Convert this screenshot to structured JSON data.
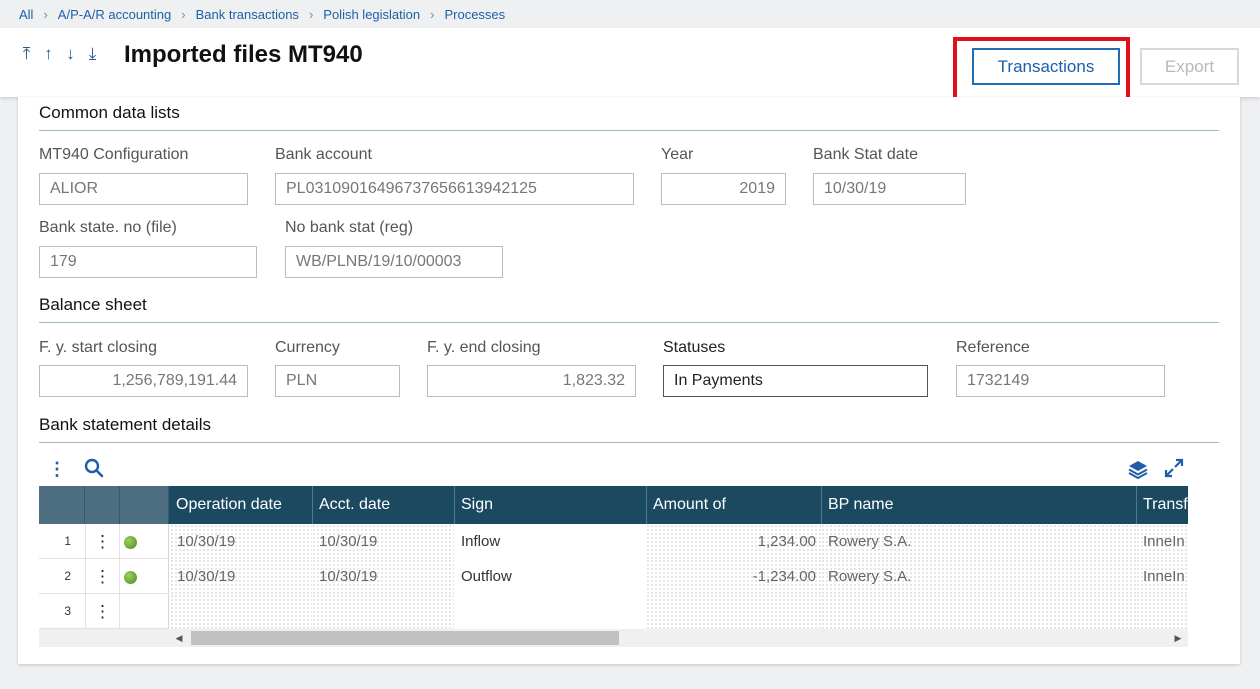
{
  "breadcrumb": [
    "All",
    "A/P-A/R accounting",
    "Bank transactions",
    "Polish legislation",
    "Processes"
  ],
  "header": {
    "title": "Imported files MT940",
    "nav": {
      "first": "⤒",
      "prev": "↑",
      "next": "↓",
      "last": "⤓"
    },
    "transactions_label": "Transactions",
    "export_label": "Export"
  },
  "common": {
    "title": "Common data lists",
    "config_label": "MT940 Configuration",
    "config_value": "ALIOR",
    "account_label": "Bank account",
    "account_value": "PL03109016496737656613942125",
    "year_label": "Year",
    "year_value": "2019",
    "statdate_label": "Bank Stat date",
    "statdate_value": "10/30/19",
    "stateno_label": "Bank state. no (file)",
    "stateno_value": "179",
    "nostat_label": "No bank stat (reg)",
    "nostat_value": "WB/PLNB/19/10/00003"
  },
  "balance": {
    "title": "Balance sheet",
    "start_label": "F. y. start closing",
    "start_value": "1,256,789,191.44",
    "currency_label": "Currency",
    "currency_value": "PLN",
    "end_label": "F. y. end closing",
    "end_value": "1,823.32",
    "statuses_label": "Statuses",
    "statuses_value": "In Payments",
    "reference_label": "Reference",
    "reference_value": "1732149"
  },
  "details": {
    "title": "Bank statement details",
    "columns": [
      "Operation date",
      "Acct. date",
      "Sign",
      "Amount of",
      "BP name",
      "Transfer"
    ],
    "rows": [
      {
        "num": "1",
        "op": "10/30/19",
        "acct": "10/30/19",
        "sign": "Inflow",
        "amount": "1,234.00",
        "bp": "Rowery S.A.",
        "transfer": "InneIn"
      },
      {
        "num": "2",
        "op": "10/30/19",
        "acct": "10/30/19",
        "sign": "Outflow",
        "amount": "-1,234.00",
        "bp": "Rowery S.A.",
        "transfer": "InneIn"
      },
      {
        "num": "3",
        "op": "",
        "acct": "",
        "sign": "",
        "amount": "",
        "bp": "",
        "transfer": ""
      }
    ]
  },
  "colors": {
    "accent": "#1f5fa8",
    "grid_header": "#1b4a60",
    "highlight": "#e0101a"
  }
}
